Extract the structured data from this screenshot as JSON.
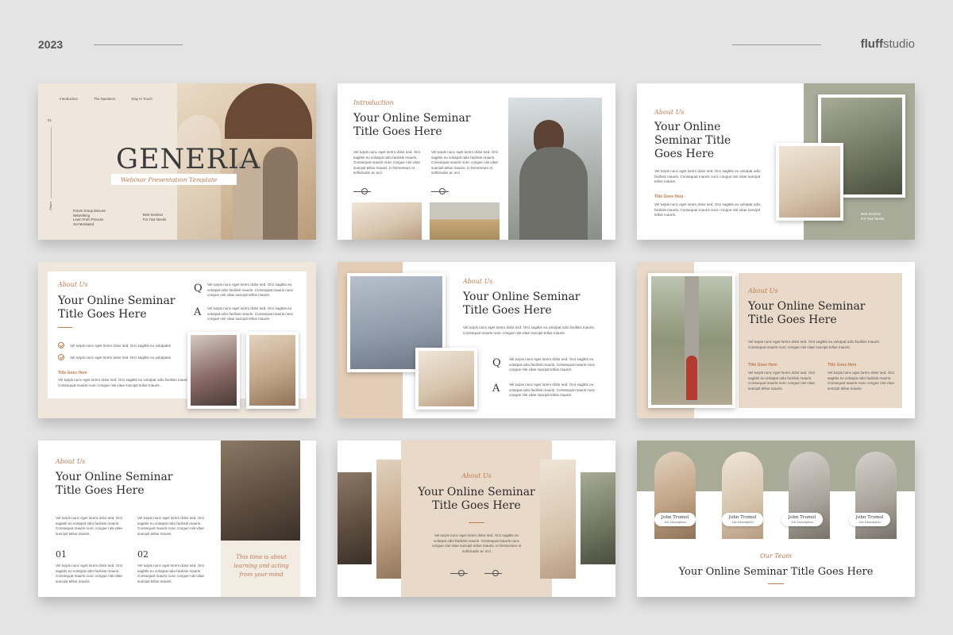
{
  "header": {
    "year": "2023",
    "brand_prefix": "fluff",
    "brand_suffix": "studio"
  },
  "lorem": "Vel turpis nunc eget lorem dolor sed. Orci sagittis eu volutpat odio facilisis mauris. Consequat mauris nunc congue nisi vitae suscipit tellus mauris. In fermentum et sollicitudin ac orci",
  "lorem_short": "Vel turpis nunc eget lorem dolor sed. Orci sagittis eu volutpat odio facilisis mauris. Consequat mauris nunc congue nisi vitae suscipit tellus mauris.",
  "slide1": {
    "nav": [
      "Introduction",
      "The Speakers",
      "Stay In Touch"
    ],
    "number": "01",
    "side_label": "Share",
    "title": "GENERIA",
    "subtitle": "Webinar Presentation Template",
    "list": [
      "Forum Group Discuss",
      "Networking",
      "Learn From Process",
      "Get Motivated"
    ],
    "tag": "Best Seminar\nFor Your Needs"
  },
  "slide2": {
    "script": "Introduction",
    "title": "Your Online Seminar Title Goes Here"
  },
  "slide3": {
    "script": "About Us",
    "title": "Your Online Seminar Title Goes Here",
    "label": "Title Goes Here",
    "tag": "Best Seminar\nFor Your Needs"
  },
  "slide4": {
    "script": "About Us",
    "title": "Your Online Seminar Title Goes Here",
    "q": "Q",
    "a": "A",
    "check1": "Vel turpis nunc eget lorem dolor sed. Orci sagittis eu volutpatis",
    "check2": "Vel turpis nunc eget lorem dolor sed. Orci sagittis eu volutpatis",
    "label": "Title Goes Here"
  },
  "slide5": {
    "script": "About Us",
    "title": "Your Online Seminar Title Goes Here",
    "q": "Q",
    "a": "A"
  },
  "slide6": {
    "script": "About Us",
    "title": "Your Online Seminar Title Goes Here",
    "label1": "Title Goes Here",
    "label2": "Title Goes Here"
  },
  "slide7": {
    "script": "About Us",
    "title": "Your Online Seminar Title Goes Here",
    "n1": "01",
    "n2": "02",
    "quote": "This time is about learning and acting from your mind"
  },
  "slide8": {
    "script": "About Us",
    "title": "Your Online Seminar Title Goes Here"
  },
  "slide9": {
    "script": "Our Team",
    "title": "Your Online Seminar Title Goes Here",
    "members": [
      {
        "name": "John Tromol",
        "role": "Job Description"
      },
      {
        "name": "John Tromol",
        "role": "Job Description"
      },
      {
        "name": "John Tromol",
        "role": "Job Description"
      },
      {
        "name": "John Tromol",
        "role": "Job Description"
      }
    ]
  },
  "colors": {
    "accent": "#c07a4f",
    "beige": "#e8d9c8",
    "sage": "#a7ab97",
    "background": "#e4e4e4"
  }
}
